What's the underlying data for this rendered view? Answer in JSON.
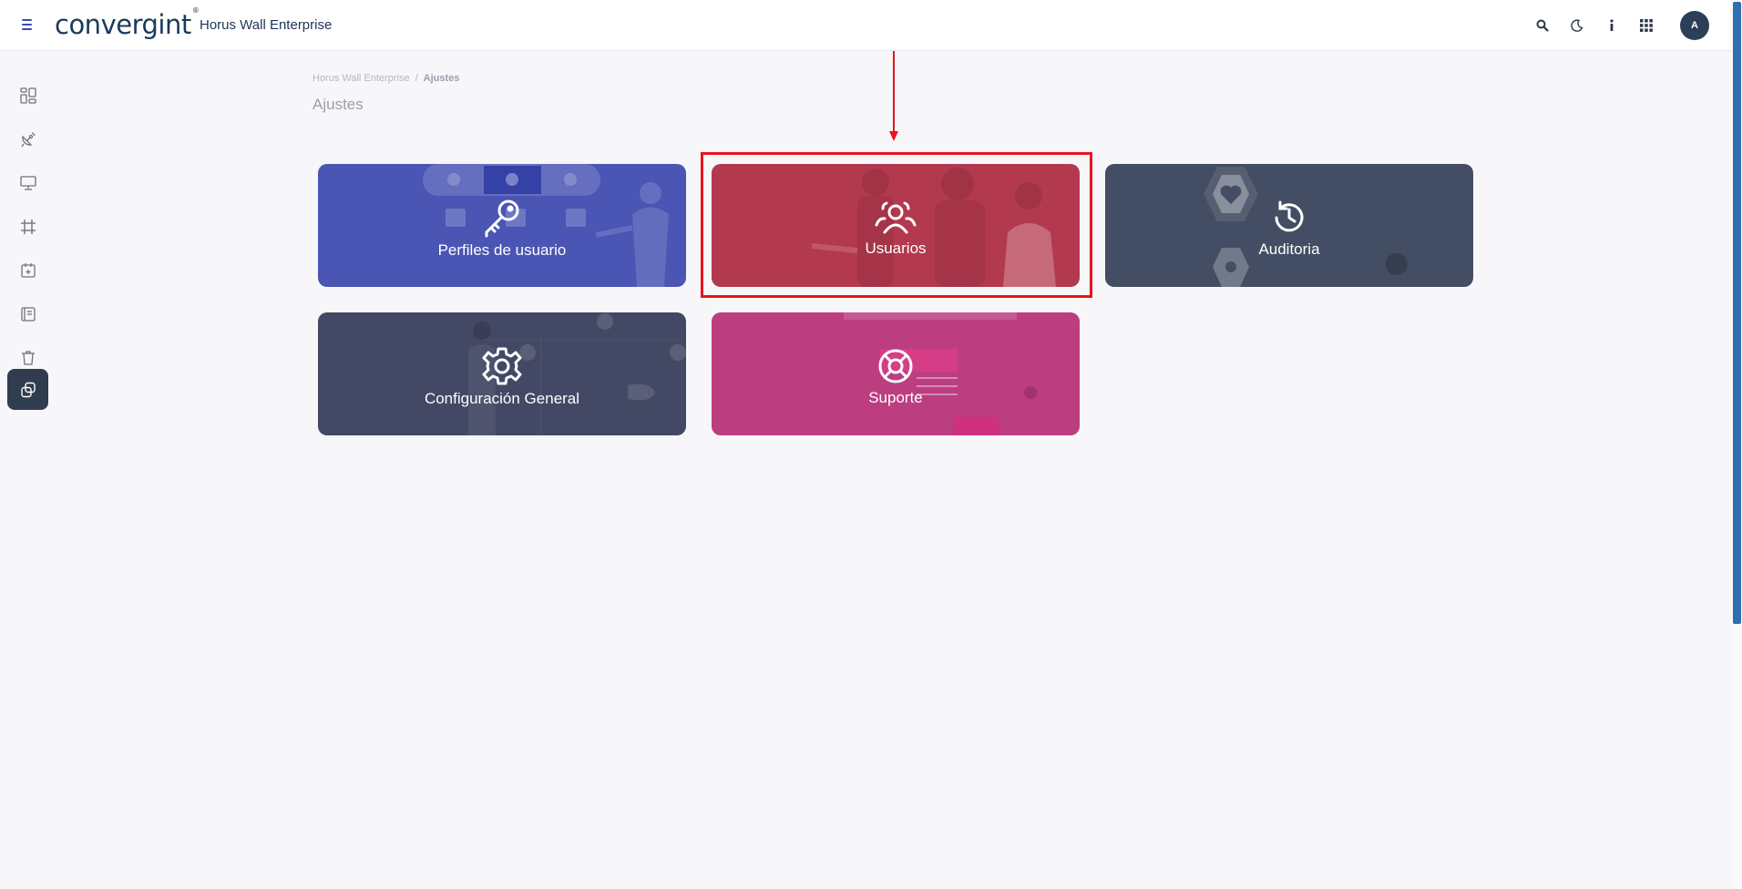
{
  "header": {
    "logo_text": "convergint",
    "app_title": "Horus Wall Enterprise",
    "avatar_initial": "A",
    "icons": [
      "search-icon",
      "moon-icon",
      "info-icon",
      "apps-grid-icon"
    ]
  },
  "sidebar": {
    "items": [
      {
        "icon": "dashboard-icon"
      },
      {
        "icon": "satellite-dish-icon"
      },
      {
        "icon": "monitor-icon"
      },
      {
        "icon": "grid-frame-icon"
      },
      {
        "icon": "calendar-plus-icon"
      },
      {
        "icon": "notebook-icon"
      },
      {
        "icon": "trash-icon"
      },
      {
        "icon": "copy-icon",
        "active": true
      }
    ]
  },
  "breadcrumb": {
    "root": "Horus Wall Enterprise",
    "separator": "/",
    "current": "Ajustes"
  },
  "page_title": "Ajustes",
  "cards": [
    {
      "label": "Perfiles de usuario",
      "icon": "key-icon",
      "color": "#4a55b4"
    },
    {
      "label": "Usuarios",
      "icon": "users-icon",
      "color": "#b3394f"
    },
    {
      "label": "Auditoria",
      "icon": "history-icon",
      "color": "#434d63"
    },
    {
      "label": "Configuración General",
      "icon": "gear-icon",
      "color": "#434965"
    },
    {
      "label": "Suporte",
      "icon": "lifebuoy-icon",
      "color": "#bc3d80"
    }
  ],
  "annotation": {
    "color": "#e8141c"
  }
}
